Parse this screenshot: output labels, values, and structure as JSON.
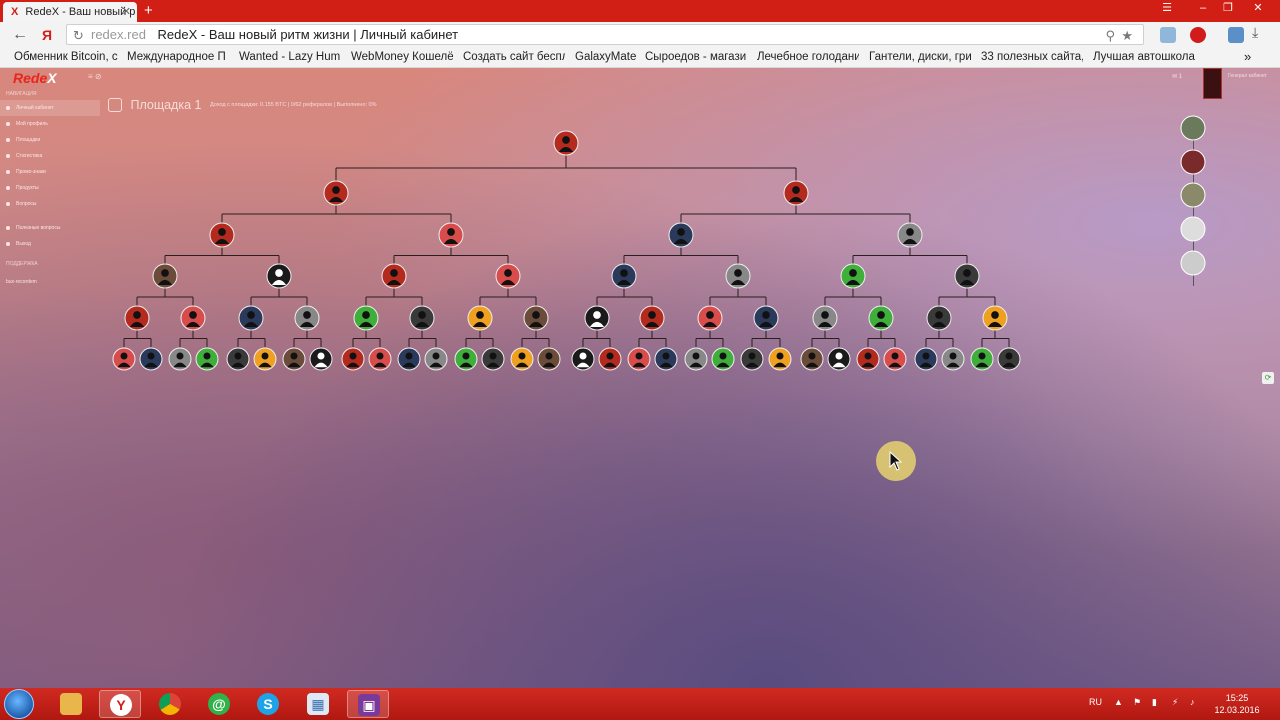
{
  "browser": {
    "tab_title": "RedeX - Ваш новый р",
    "tab_close": "✕",
    "new_tab": "+",
    "url_host": "redex.red",
    "url_title": "RedeX - Ваш новый ритм жизни | Личный кабинет",
    "bookmarks": [
      "Обменник Bitcoin, с",
      "Международное П",
      "Wanted - Lazy Hum:",
      "WebMoney Кошелё",
      "Создать сайт беспл",
      "GalaxyMate",
      "Сыроедов - магази",
      "Лечебное голодани",
      "Гантели, диски, гри",
      "33 полезных сайта,",
      "Лучшая автошкола"
    ],
    "bookmarks_more": "»"
  },
  "site": {
    "logo_main": "Rede",
    "logo_accent": "X",
    "top_icons": "≡  ⊘",
    "sidebar_heading": "НАВИГАЦИЯ",
    "sidebar_items": [
      "Личный кабинет",
      "Мой профиль",
      "Площадки",
      "Статистика",
      "Промо-знаки",
      "Продукты",
      "Вопросы",
      "Полезные вопросы",
      "Выход"
    ],
    "sidebar_footer_heading": "ПОДДЕРЖКА",
    "sidebar_footer": "bux-recordem",
    "platform_title": "Площадка 1",
    "platform_info": "Доход с площадки: 0.155 BTC | 0/62 рефералов | Выполнено: 0%",
    "user_name": "Генерал кабинет",
    "user_menu": "✉ 1"
  },
  "taskbar": {
    "lang": "RU",
    "time": "15:25",
    "date": "12.03.2016"
  },
  "colors": {
    "browser_red": "#d11f15",
    "logo_red": "#e8261b"
  }
}
